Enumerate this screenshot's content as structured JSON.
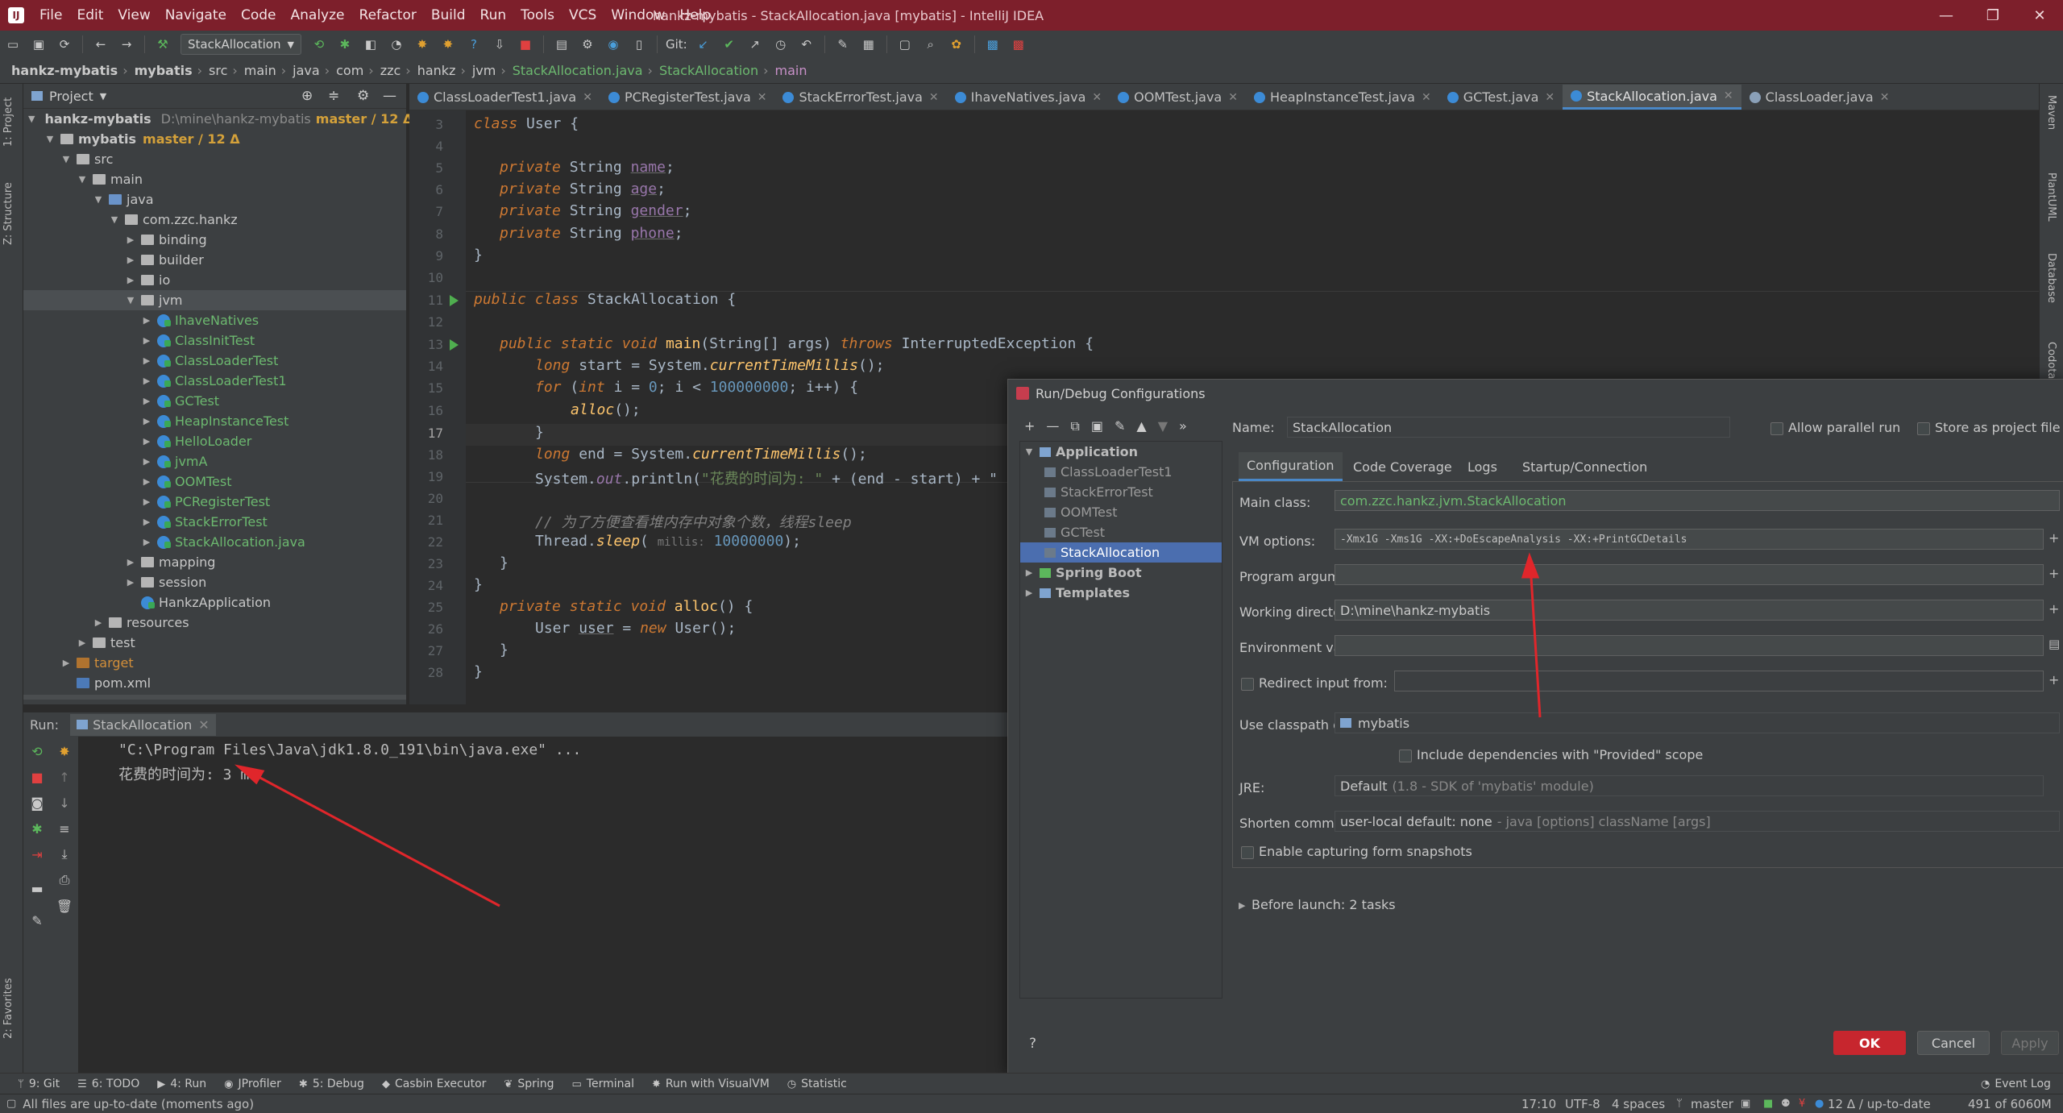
{
  "window": {
    "title": "hankz-mybatis - StackAllocation.java [mybatis] - IntelliJ IDEA",
    "logo": "IJ",
    "controls": [
      "—",
      "❐",
      "✕"
    ]
  },
  "menu": [
    "File",
    "Edit",
    "View",
    "Navigate",
    "Code",
    "Analyze",
    "Refactor",
    "Build",
    "Run",
    "Tools",
    "VCS",
    "Window",
    "Help"
  ],
  "toolbar": {
    "run_config": "StackAllocation",
    "git_label": "Git:"
  },
  "breadcrumbs": [
    "hankz-mybatis",
    "mybatis",
    "src",
    "main",
    "java",
    "com",
    "zzc",
    "hankz",
    "jvm",
    "StackAllocation.java",
    "StackAllocation",
    "main"
  ],
  "left_stripe": {
    "project": "1: Project",
    "structure": "Z: Structure",
    "favorites": "2: Favorites"
  },
  "right_stripe": [
    "Maven",
    "PlantUML",
    "Database",
    "Codota"
  ],
  "project_panel": {
    "title": "Project",
    "root": {
      "name": "hankz-mybatis",
      "path": "D:\\mine\\hankz-mybatis",
      "branch": "master / 12 Δ"
    },
    "module": {
      "name": "mybatis",
      "branch": "master / 12 Δ"
    },
    "tree": [
      {
        "label": "src",
        "indent": 2,
        "type": "folder",
        "open": true
      },
      {
        "label": "main",
        "indent": 3,
        "type": "folder",
        "open": true
      },
      {
        "label": "java",
        "indent": 4,
        "type": "folder-blue",
        "open": true
      },
      {
        "label": "com.zzc.hankz",
        "indent": 5,
        "type": "folder",
        "open": true
      },
      {
        "label": "binding",
        "indent": 6,
        "type": "folder",
        "open": false
      },
      {
        "label": "builder",
        "indent": 6,
        "type": "folder",
        "open": false
      },
      {
        "label": "io",
        "indent": 6,
        "type": "folder",
        "open": false
      },
      {
        "label": "jvm",
        "indent": 6,
        "type": "folder",
        "open": true,
        "selected": true
      },
      {
        "label": "IhaveNatives",
        "indent": 7,
        "type": "class"
      },
      {
        "label": "ClassInitTest",
        "indent": 7,
        "type": "class"
      },
      {
        "label": "ClassLoaderTest",
        "indent": 7,
        "type": "class"
      },
      {
        "label": "ClassLoaderTest1",
        "indent": 7,
        "type": "class"
      },
      {
        "label": "GCTest",
        "indent": 7,
        "type": "class"
      },
      {
        "label": "HeapInstanceTest",
        "indent": 7,
        "type": "class"
      },
      {
        "label": "HelloLoader",
        "indent": 7,
        "type": "class"
      },
      {
        "label": "jvmA",
        "indent": 7,
        "type": "class"
      },
      {
        "label": "OOMTest",
        "indent": 7,
        "type": "class"
      },
      {
        "label": "PCRegisterTest",
        "indent": 7,
        "type": "class"
      },
      {
        "label": "StackErrorTest",
        "indent": 7,
        "type": "class"
      },
      {
        "label": "StackAllocation.java",
        "indent": 7,
        "type": "class"
      },
      {
        "label": "mapping",
        "indent": 6,
        "type": "folder",
        "open": false
      },
      {
        "label": "session",
        "indent": 6,
        "type": "folder",
        "open": false
      },
      {
        "label": "HankzApplication",
        "indent": 6,
        "type": "class-plain"
      },
      {
        "label": "resources",
        "indent": 4,
        "type": "folder",
        "open": false
      },
      {
        "label": "test",
        "indent": 3,
        "type": "folder",
        "open": false
      },
      {
        "label": "target",
        "indent": 2,
        "type": "folder-orange",
        "open": false
      },
      {
        "label": "pom.xml",
        "indent": 2,
        "type": "maven"
      }
    ]
  },
  "editor_tabs": [
    {
      "label": "ClassLoaderTest1.java"
    },
    {
      "label": "PCRegisterTest.java"
    },
    {
      "label": "StackErrorTest.java"
    },
    {
      "label": "IhaveNatives.java"
    },
    {
      "label": "OOMTest.java"
    },
    {
      "label": "HeapInstanceTest.java"
    },
    {
      "label": "GCTest.java"
    },
    {
      "label": "StackAllocation.java",
      "active": true
    },
    {
      "label": "ClassLoader.java"
    }
  ],
  "code": {
    "line_numbers": [
      "3",
      "4",
      "5",
      "6",
      "7",
      "8",
      "9",
      "10",
      "11",
      "12",
      "13",
      "14",
      "15",
      "16",
      "17",
      "18",
      "19",
      "20",
      "21",
      "22",
      "23",
      "24",
      "25",
      "26",
      "27",
      "28"
    ],
    "l3": [
      "class",
      "User",
      "{"
    ],
    "l5": [
      "private",
      "String",
      "name",
      ";"
    ],
    "l6": [
      "private",
      "String",
      "age",
      ";"
    ],
    "l7": [
      "private",
      "String",
      "gender",
      ";"
    ],
    "l8": [
      "private",
      "String",
      "phone",
      ";"
    ],
    "l9": "}",
    "l11": [
      "public",
      "class",
      "StackAllocation",
      "{"
    ],
    "l13": [
      "public",
      "static",
      "void",
      "main",
      "(String[] args)",
      "throws",
      "InterruptedException",
      "{"
    ],
    "l14": [
      "long",
      "start = System.",
      "currentTimeMillis",
      "();"
    ],
    "l15": [
      "for",
      "(",
      "int",
      "i = ",
      "0",
      "; i < ",
      "100000000",
      "; i++) {"
    ],
    "l16": [
      "alloc",
      "();"
    ],
    "l17": "}",
    "l18": [
      "long",
      "end = System.",
      "currentTimeMillis",
      "();"
    ],
    "l19": [
      "System.",
      "out",
      ".println(",
      "\"花费的时间为: \"",
      " + (end - start) + \""
    ],
    "l21": "// 为了方便查看堆内存中对象个数，线程sleep",
    "l22": [
      "Thread.",
      "sleep",
      "(",
      "millis:",
      "10000000",
      ");"
    ],
    "l23": "}",
    "l24": "}",
    "l25": [
      "private",
      "static",
      "void",
      "alloc",
      "() {"
    ],
    "l26": [
      "User",
      "user",
      " = ",
      "new",
      "User();"
    ],
    "l27": "}",
    "l28": "}"
  },
  "run_panel": {
    "label": "Run:",
    "tab": "StackAllocation",
    "output": [
      "\"C:\\Program Files\\Java\\jdk1.8.0_191\\bin\\java.exe\" ...",
      "花费的时间为: 3 ms"
    ]
  },
  "dialog": {
    "title": "Run/Debug Configurations",
    "tree": [
      {
        "label": "Application",
        "level": 0,
        "bold": true,
        "open": true
      },
      {
        "label": "ClassLoaderTest1",
        "level": 1
      },
      {
        "label": "StackErrorTest",
        "level": 1
      },
      {
        "label": "OOMTest",
        "level": 1
      },
      {
        "label": "GCTest",
        "level": 1
      },
      {
        "label": "StackAllocation",
        "level": 1,
        "selected": true
      },
      {
        "label": "Spring Boot",
        "level": 0,
        "bold": true,
        "open": false
      },
      {
        "label": "Templates",
        "level": 0,
        "bold": true,
        "open": false
      }
    ],
    "name_label": "Name:",
    "name_value": "StackAllocation",
    "allow_parallel": "Allow parallel run",
    "store_as_project": "Store as project file",
    "tabs": [
      "Configuration",
      "Code Coverage",
      "Logs",
      "Startup/Connection"
    ],
    "fields": {
      "main_class_label": "Main class:",
      "main_class": "com.zzc.hankz.jvm.StackAllocation",
      "vm_options_label": "VM options:",
      "vm_options": "-Xmx1G -Xms1G -XX:+DoEscapeAnalysis -XX:+PrintGCDetails",
      "program_args_label": "Program arguments:",
      "program_args": "",
      "working_dir_label": "Working directory:",
      "working_dir": "D:\\mine\\hankz-mybatis",
      "env_vars_label": "Environment variables:",
      "env_vars": "",
      "redirect_label": "Redirect input from:",
      "classpath_label": "Use classpath of module:",
      "classpath": "mybatis",
      "include_deps": "Include dependencies with \"Provided\" scope",
      "jre_label": "JRE:",
      "jre_default": "Default",
      "jre_detail": "(1.8 - SDK of 'mybatis' module)",
      "shorten_label": "Shorten command line:",
      "shorten_value": "user-local default: none",
      "shorten_hint": "- java [options] className [args]",
      "enable_snapshots": "Enable capturing form snapshots"
    },
    "before_launch": "Before launch: 2 tasks",
    "help": "?",
    "ok": "OK",
    "cancel": "Cancel",
    "apply": "Apply"
  },
  "bottom_tools": [
    {
      "label": "9: Git",
      "icon": "git-icon"
    },
    {
      "label": "6: TODO",
      "icon": "todo-icon"
    },
    {
      "label": "4: Run",
      "icon": "run-icon"
    },
    {
      "label": "JProfiler",
      "icon": "profiler-icon"
    },
    {
      "label": "5: Debug",
      "icon": "debug-icon"
    },
    {
      "label": "Casbin Executor",
      "icon": "casbin-icon"
    },
    {
      "label": "Spring",
      "icon": "spring-icon"
    },
    {
      "label": "Terminal",
      "icon": "terminal-icon"
    },
    {
      "label": "Run with VisualVM",
      "icon": "visualvm-icon"
    },
    {
      "label": "Statistic",
      "icon": "statistic-icon"
    }
  ],
  "event_log": "Event Log",
  "status": {
    "message": "All files are up-to-date (moments ago)",
    "position": "17:10",
    "encoding": "UTF-8",
    "indent": "4 spaces",
    "branch": "master",
    "vcs": "12 Δ / up-to-date",
    "memory": "491 of 6060M"
  },
  "colors": {
    "titlebar": "#7d1f2b",
    "accent": "#4a88c7",
    "ok_button": "#c7262e",
    "annotation_arrow": "#e0262b"
  }
}
